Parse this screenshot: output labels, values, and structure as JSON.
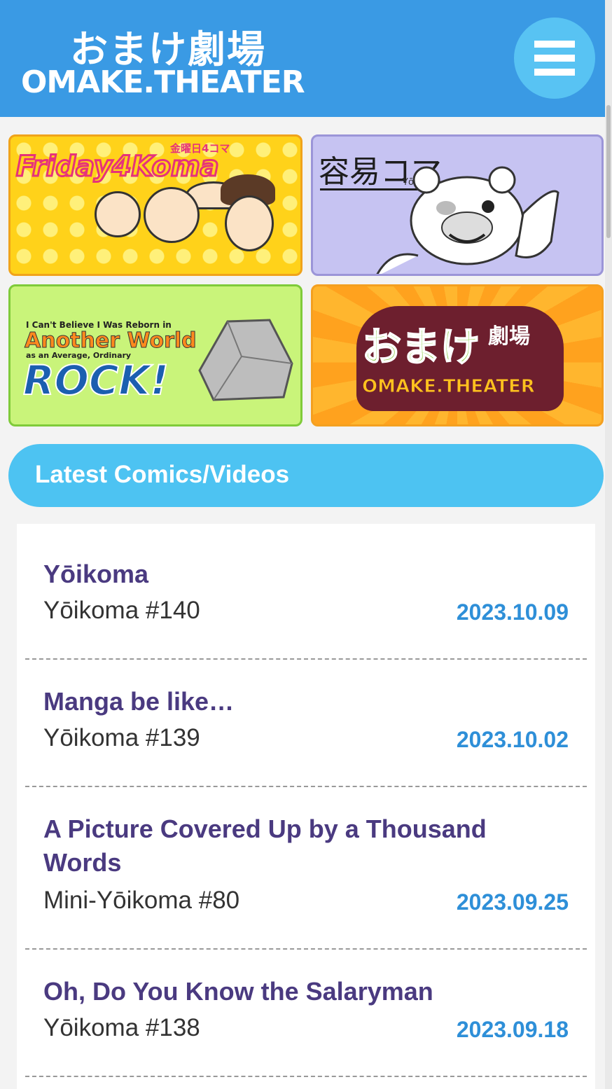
{
  "header": {
    "logo_jp": "おまけ劇場",
    "logo_en": "OMAKE.THEATER",
    "menu_icon": "hamburger-menu-icon"
  },
  "banners": {
    "friday": {
      "title": "Friday4Koma",
      "subtitle": "金曜日4コマ"
    },
    "yoikoma": {
      "title": "容易コマ",
      "subtitle": "Yōikoma"
    },
    "rock": {
      "line1": "I Can't Believe I Was Reborn in",
      "line2": "Another World",
      "line3": "as an Average, Ordinary",
      "line4": "ROCK!"
    },
    "omake": {
      "jp": "おまけ",
      "jp2": "劇場",
      "en": "OMAKE.THEATER"
    }
  },
  "section": {
    "title": "Latest Comics/Videos"
  },
  "items": [
    {
      "title": "Yōikoma",
      "series": "Yōikoma #140",
      "date": "2023.10.09"
    },
    {
      "title": "Manga be like…",
      "series": "Yōikoma #139",
      "date": "2023.10.02"
    },
    {
      "title": "A Picture Covered Up by a Thousand Words",
      "series": "Mini-Yōikoma #80",
      "date": "2023.09.25"
    },
    {
      "title": "Oh, Do You Know the Salaryman",
      "series": "Yōikoma #138",
      "date": "2023.09.18"
    }
  ],
  "colors": {
    "header_bg": "#3a9ae4",
    "accent": "#4dc3f2",
    "title_color": "#4a3a80",
    "date_color": "#2e8fd8"
  }
}
